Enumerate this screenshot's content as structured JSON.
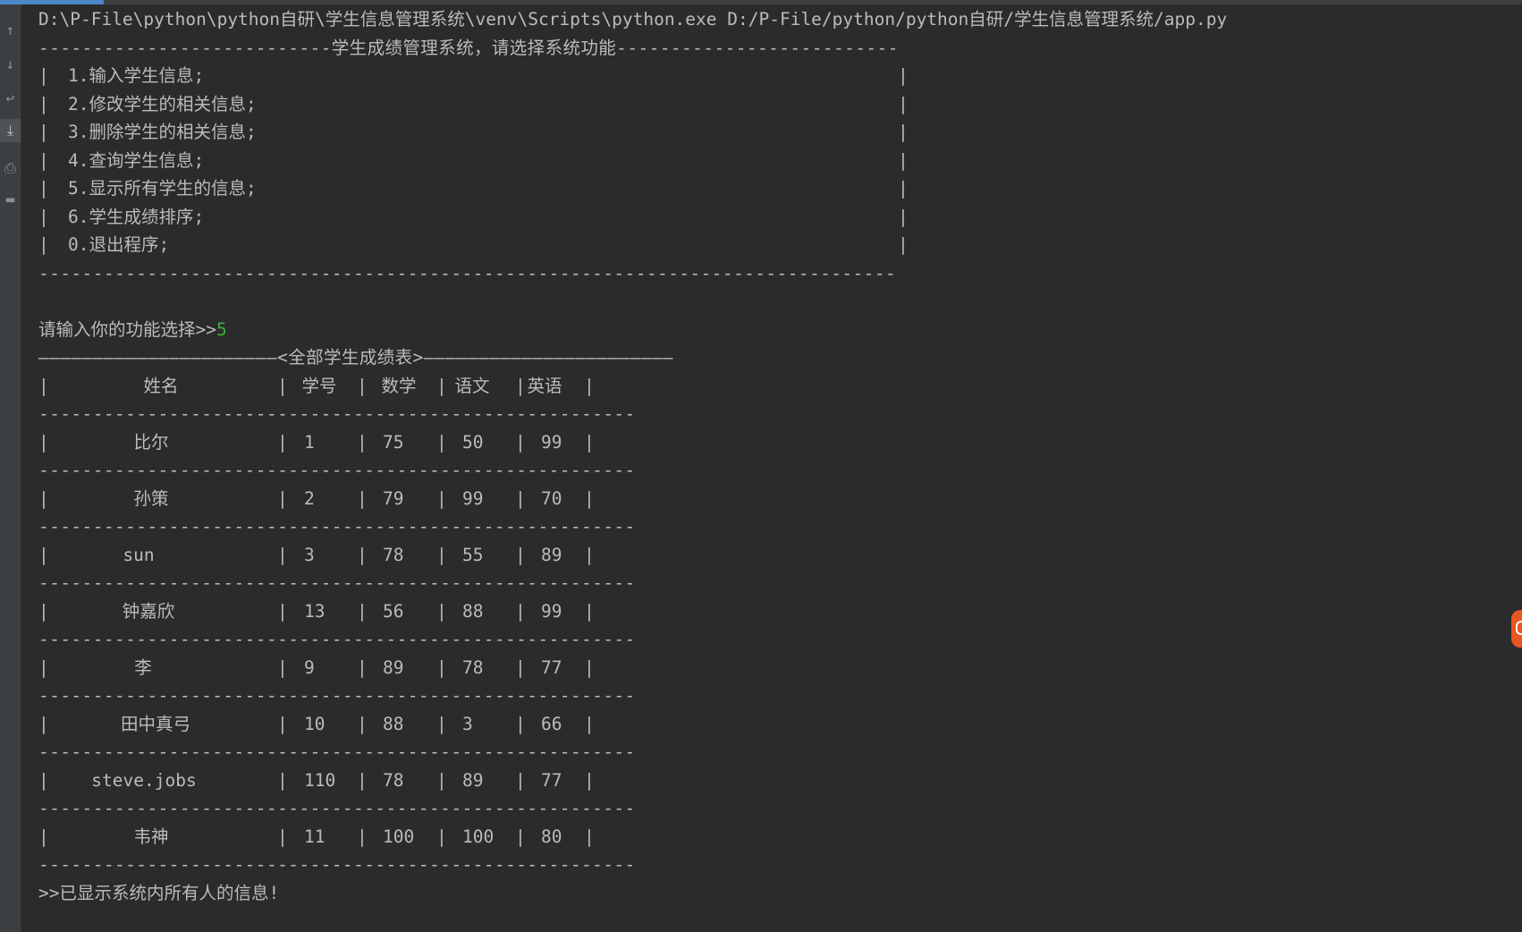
{
  "run_command": "D:\\P-File\\python\\python自研\\学生信息管理系统\\venv\\Scripts\\python.exe D:/P-File/python/python自研/学生信息管理系统/app.py",
  "menu": {
    "header_line": "---------------------------学生成绩管理系统，请选择系统功能--------------------------",
    "border_char": "|",
    "items": [
      "1.输入学生信息;",
      "2.修改学生的相关信息;",
      "3.删除学生的相关信息;",
      "4.查询学生信息;",
      "5.显示所有学生的信息;",
      "6.学生成绩排序;",
      "0.退出程序;"
    ],
    "footer_line": "-------------------------------------------------------------------------------"
  },
  "prompt": {
    "text": "请输入你的功能选择>>",
    "input_value": "5"
  },
  "table": {
    "title_line": "——————————————————————<全部学生成绩表>———————————————————————",
    "border_char": "|",
    "separator": "-------------------------------------------------------",
    "headers": [
      "姓名",
      "学号",
      "数学",
      "语文",
      "英语"
    ],
    "rows": [
      [
        "比尔",
        "1",
        "75",
        "50",
        "99"
      ],
      [
        "孙策",
        "2",
        "79",
        "99",
        "70"
      ],
      [
        "sun",
        "3",
        "78",
        "55",
        "89"
      ],
      [
        "钟嘉欣",
        "13",
        "56",
        "88",
        "99"
      ],
      [
        "李",
        "9",
        "89",
        "78",
        "77"
      ],
      [
        "田中真弓",
        "10",
        "88",
        "3",
        "66"
      ],
      [
        "steve.jobs",
        "110",
        "78",
        "89",
        "77"
      ],
      [
        "韦神",
        "11",
        "100",
        "100",
        "80"
      ]
    ]
  },
  "result_message": ">>已显示系统内所有人的信息!",
  "gutter_icons": [
    "arrow-up-icon",
    "arrow-down-icon",
    "soft-wrap-icon",
    "scroll-to-end-icon",
    "print-icon",
    "trash-icon"
  ],
  "progress": 0.068,
  "colors": {
    "background": "#2b2b2b",
    "text": "#bbbbbb",
    "input_text": "#3fae3f",
    "gutter": "#3c3f41",
    "progress_accent": "#4a88c7",
    "badge": "#e8561f"
  }
}
